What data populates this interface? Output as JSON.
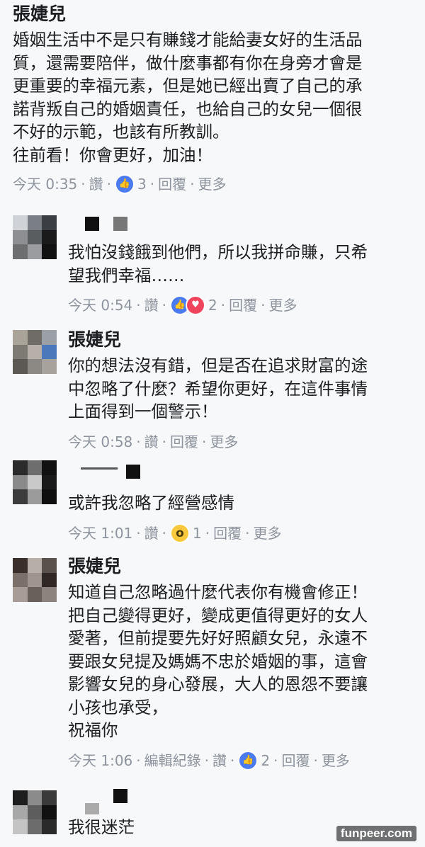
{
  "top_comment": {
    "author": "張婕兒",
    "text": "婚姻生活中不是只有賺錢才能給妻女好的生活品\n質，還需要陪伴，做什麼事都有你在身旁才會是\n更重要的幸福元素，但是她已經出賣了自己的承\n諾背叛自己的婚姻責任，也給自己的女兒一個很\n不好的示範，也該有所教訓。\n往前看！你會更好，加油！",
    "time": "今天 0:35",
    "like_label": "讚",
    "reaction_count": "3",
    "reply_label": "回覆",
    "more_label": "更多"
  },
  "replies": [
    {
      "author": "",
      "text": "我怕沒錢餓到他們，所以我拼命賺，只希\n望我們幸福……",
      "time": "今天 0:54",
      "like_label": "讚",
      "reaction_count": "2",
      "reply_label": "回覆",
      "more_label": "更多"
    },
    {
      "author": "張婕兒",
      "text": "你的想法沒有錯，但是否在追求財富的途\n中忽略了什麼？希望你更好，在這件事情\n上面得到一個警示！",
      "time": "今天 0:58",
      "like_label": "讚",
      "reply_label": "回覆",
      "more_label": "更多"
    },
    {
      "author": "",
      "text": "或許我忽略了經營感情",
      "time": "今天 1:01",
      "like_label": "讚",
      "reaction_count": "1",
      "reply_label": "回覆",
      "more_label": "更多"
    },
    {
      "author": "張婕兒",
      "text": "知道自己忽略過什麼代表你有機會修正！\n把自己變得更好，變成更值得更好的女人\n愛著，但前提要先好好照顧女兒，永遠不\n要跟女兒提及媽媽不忠於婚姻的事，這會\n影響女兒的身心發展，大人的恩怨不要讓\n小孩也承受，\n祝福你",
      "time": "今天 1:06",
      "edit_history_label": "編輯紀錄",
      "like_label": "讚",
      "reaction_count": "2",
      "reply_label": "回覆",
      "more_label": "更多"
    },
    {
      "author": "",
      "text": "我很迷茫"
    }
  ],
  "icons": {
    "like": "thumbs-up-icon",
    "love": "heart-icon",
    "wow": "wow-face-icon"
  },
  "colors": {
    "background": "#f7f8fa",
    "meta_text": "#8d949e",
    "like_blue": "#4a7bf0",
    "love_red": "#f0445c",
    "wow_yellow": "#f8c93d"
  },
  "watermark": "funpeer.com"
}
